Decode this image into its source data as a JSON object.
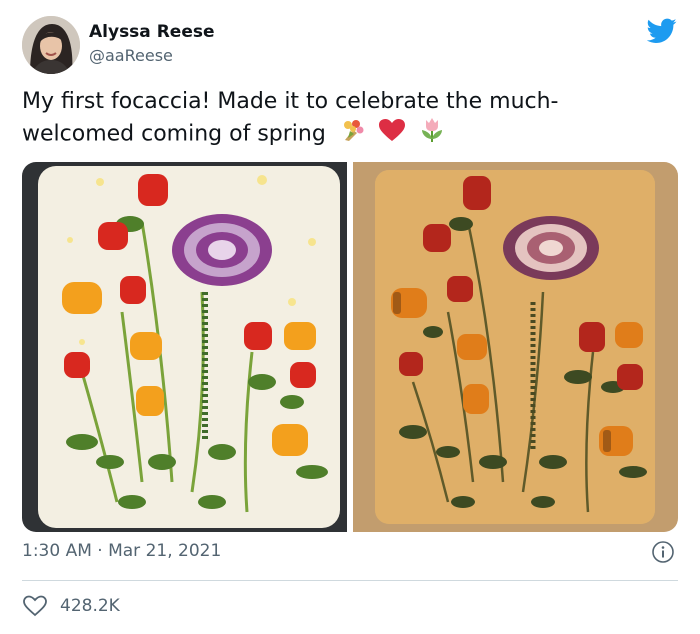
{
  "user": {
    "name": "Alyssa Reese",
    "handle": "@aaReese"
  },
  "tweet": {
    "text": "My first focaccia! Made it to celebrate the much-welcomed coming of spring",
    "emojis": [
      "bouquet",
      "red-heart",
      "tulip"
    ],
    "timestamp": "1:30 AM · Mar 21, 2021",
    "like_count": "428.2K"
  },
  "icons": {
    "logo": "twitter-bird-icon",
    "info": "info-icon",
    "like": "heart-outline-icon"
  },
  "colors": {
    "twitter_blue": "#1d9bf0",
    "secondary_text": "#536471",
    "divider": "#cfd9de"
  }
}
